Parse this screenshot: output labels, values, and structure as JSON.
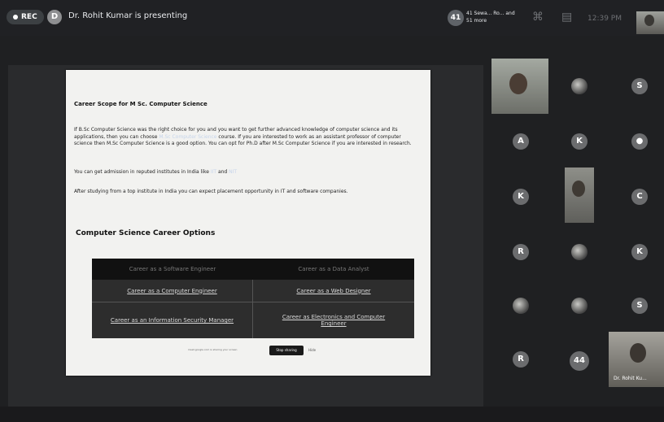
{
  "topbar": {
    "rec_label": "REC",
    "presenter_initial": "D",
    "presenter_text": "Dr. Rohit Kumar is presenting",
    "participant_count": "41",
    "participant_text": "41 Sewa... Ro... and 51 more",
    "clock": "12:39 PM"
  },
  "slide": {
    "title": "Career Scope for M Sc. Computer Science",
    "para1_a": "If B.Sc Computer Science was the right choice for you and you want to get further advanced knowledge of computer science and its applications, then you can choose ",
    "para1_link": "M.Sc Computer Science",
    "para1_b": " course. If you are interested to work as an assistant professor of computer science then M.Sc Computer Science is a good option. You can opt for Ph.D after M.Sc Computer Science if you are interested in research.",
    "para2_a": "You can get admission in reputed institutes in India like ",
    "para2_link1": "IIT",
    "para2_and": " and ",
    "para2_link2": "NIT",
    "para3": "After studying from a top institute in India you can expect placement opportunity in IT and software companies.",
    "section_title": "Computer Science Career Options",
    "careers": [
      "Career as a Software Engineer",
      "Career as a Data Analyst",
      "Career as a Computer Engineer",
      "Career as a Web Designer",
      "Career as an Information Security Manager",
      "Career as Electronics and Computer Engineer"
    ],
    "share_text": "meet.google.com is sharing your screen",
    "stop_label": "Stop sharing",
    "hide_label": "Hide"
  },
  "participants": {
    "tiles": [
      "S",
      "A",
      "K",
      "K",
      "C",
      "R",
      "K",
      "S",
      "R",
      "44"
    ],
    "video_label": "Dr. Rohit Ku..."
  }
}
